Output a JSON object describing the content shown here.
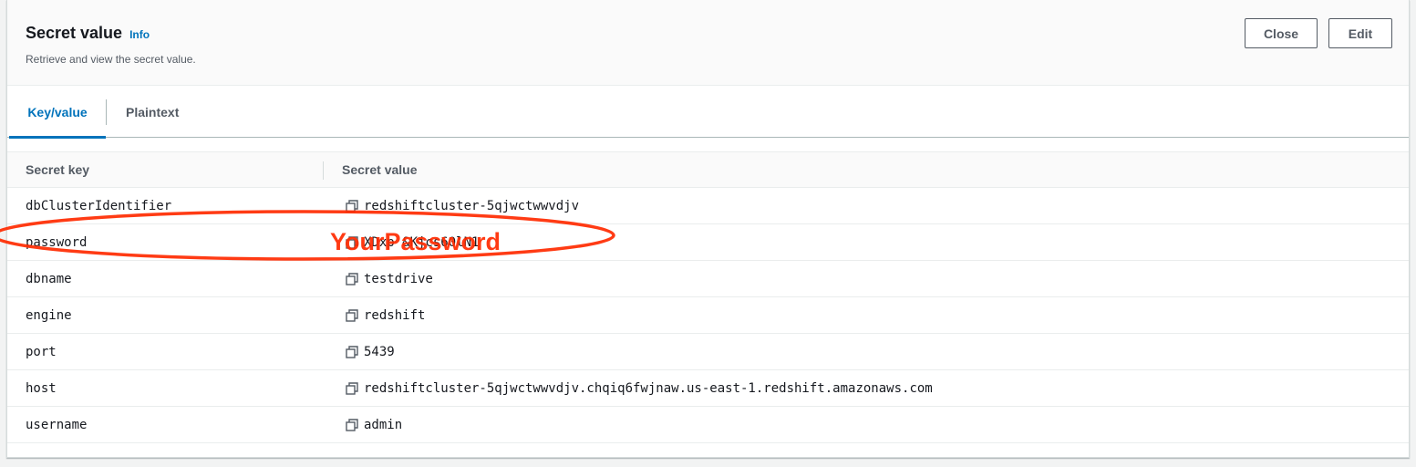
{
  "header": {
    "title": "Secret value",
    "info_link": "Info",
    "subtitle": "Retrieve and view the secret value.",
    "close_label": "Close",
    "edit_label": "Edit"
  },
  "tabs": [
    {
      "label": "Key/value",
      "selected": true
    },
    {
      "label": "Plaintext",
      "selected": false
    }
  ],
  "table": {
    "columns": [
      "Secret key",
      "Secret value"
    ],
    "rows": [
      {
        "key": "dbClusterIdentifier",
        "value": "redshiftcluster-5qjwctwwvdjv"
      },
      {
        "key": "password",
        "value": "XDxp &Kjcs60lN1"
      },
      {
        "key": "dbname",
        "value": "testdrive"
      },
      {
        "key": "engine",
        "value": "redshift"
      },
      {
        "key": "port",
        "value": "5439"
      },
      {
        "key": "host",
        "value": "redshiftcluster-5qjwctwwvdjv.chqiq6fwjnaw.us-east-1.redshift.amazonaws.com"
      },
      {
        "key": "username",
        "value": "admin"
      }
    ]
  },
  "annotation": {
    "text": "YourPassword",
    "color": "#ff2a00"
  },
  "colors": {
    "accent": "#0073bb",
    "border": "#eaeded"
  }
}
